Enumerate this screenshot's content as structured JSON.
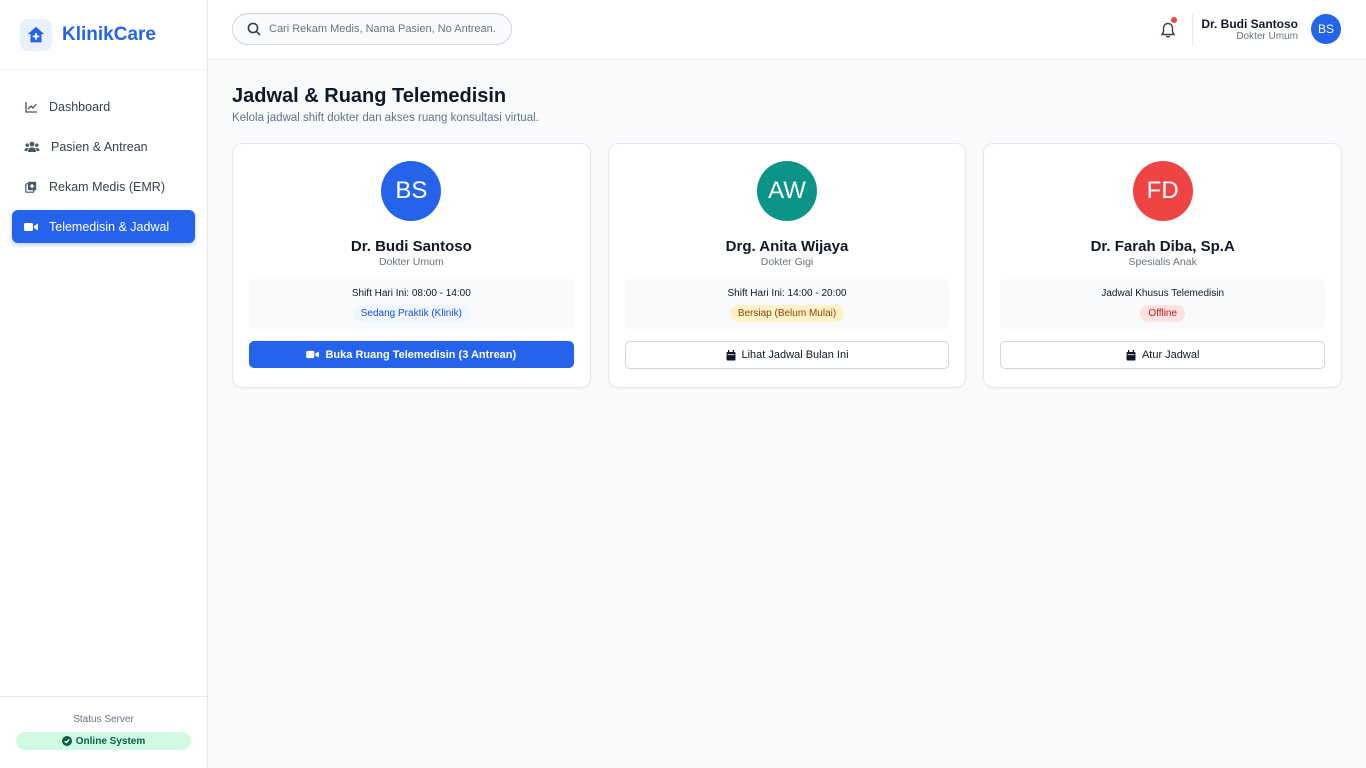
{
  "brand": {
    "name": "KlinikCare"
  },
  "colors": {
    "primary": "#2563eb",
    "success_bg": "#d1fae5",
    "success_text": "#065f46"
  },
  "sidebar": {
    "items": [
      {
        "label": "Dashboard",
        "icon": "chart-line-icon",
        "active": false
      },
      {
        "label": "Pasien & Antrean",
        "icon": "users-icon",
        "active": false
      },
      {
        "label": "Rekam Medis (EMR)",
        "icon": "medical-record-icon",
        "active": false
      },
      {
        "label": "Telemedisin & Jadwal",
        "icon": "video-icon",
        "active": true
      }
    ],
    "footer": {
      "label": "Status Server",
      "status": "Online System"
    }
  },
  "header": {
    "search": {
      "placeholder": "Cari Rekam Medis, Nama Pasien, No Antrean...",
      "value": ""
    },
    "user": {
      "name": "Dr. Budi Santoso",
      "role": "Dokter Umum",
      "initials": "BS"
    }
  },
  "page": {
    "title": "Jadwal & Ruang Telemedisin",
    "subtitle": "Kelola jadwal shift dokter dan akses ruang konsultasi virtual."
  },
  "doctors": [
    {
      "initials": "BS",
      "avatar_color": "#2563eb",
      "name": "Dr. Budi Santoso",
      "role": "Dokter Umum",
      "shift": "Shift Hari Ini: 08:00 - 14:00",
      "status": "Sedang Praktik (Klinik)",
      "status_bg": "#eff6ff",
      "status_color": "#1d4ed8",
      "action": "Buka Ruang Telemedisin (3 Antrean)",
      "action_icon": "video-icon",
      "action_style": "primary"
    },
    {
      "initials": "AW",
      "avatar_color": "#0d9488",
      "name": "Drg. Anita Wijaya",
      "role": "Dokter Gigi",
      "shift": "Shift Hari Ini: 14:00 - 20:00",
      "status": "Bersiap (Belum Mulai)",
      "status_bg": "#fef3c7",
      "status_color": "#92400e",
      "action": "Lihat Jadwal Bulan Ini",
      "action_icon": "calendar-icon",
      "action_style": "outline"
    },
    {
      "initials": "FD",
      "avatar_color": "#ef4444",
      "name": "Dr. Farah Diba, Sp.A",
      "role": "Spesialis Anak",
      "shift": "Jadwal Khusus Telemedisin",
      "status": "Offline",
      "status_bg": "#fee2e2",
      "status_color": "#b91c1c",
      "action": "Atur Jadwal",
      "action_icon": "calendar-icon",
      "action_style": "outline"
    }
  ]
}
